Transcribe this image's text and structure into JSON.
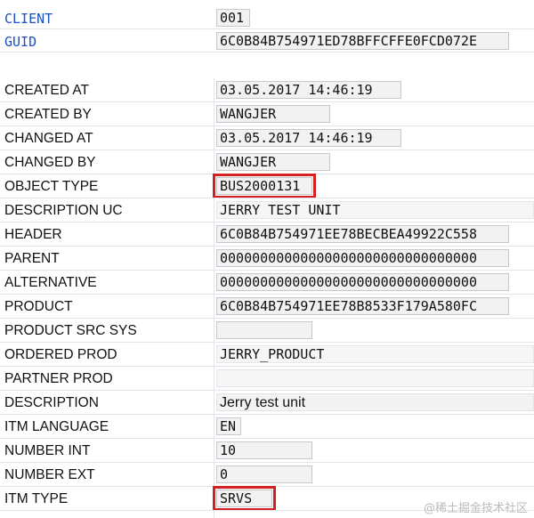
{
  "rows": [
    {
      "label": "CLIENT",
      "value": "001"
    },
    {
      "label": "GUID",
      "value": "6C0B84B754971ED78BFFCFFE0FCD072E"
    },
    {
      "label": "CREATED AT",
      "value": "03.05.2017 14:46:19"
    },
    {
      "label": "CREATED BY",
      "value": "WANGJER"
    },
    {
      "label": "CHANGED AT",
      "value": "03.05.2017 14:46:19"
    },
    {
      "label": "CHANGED BY",
      "value": "WANGJER"
    },
    {
      "label": "OBJECT TYPE",
      "value": "BUS2000131"
    },
    {
      "label": "DESCRIPTION UC",
      "value": "JERRY TEST UNIT"
    },
    {
      "label": "HEADER",
      "value": "6C0B84B754971EE78BECBEA49922C558"
    },
    {
      "label": "PARENT",
      "value": "00000000000000000000000000000000"
    },
    {
      "label": "ALTERNATIVE",
      "value": "00000000000000000000000000000000"
    },
    {
      "label": "PRODUCT",
      "value": "6C0B84B754971EE78B8533F179A580FC"
    },
    {
      "label": "PRODUCT SRC SYS",
      "value": ""
    },
    {
      "label": "ORDERED PROD",
      "value": "JERRY_PRODUCT"
    },
    {
      "label": "PARTNER PROD",
      "value": ""
    },
    {
      "label": "DESCRIPTION",
      "value": "Jerry test unit"
    },
    {
      "label": "ITM LANGUAGE",
      "value": "EN"
    },
    {
      "label": "NUMBER INT",
      "value": "10"
    },
    {
      "label": "NUMBER EXT",
      "value": "0"
    },
    {
      "label": "ITM TYPE",
      "value": "SRVS"
    }
  ],
  "highlight_color": "#d42020",
  "watermark": "@稀土掘金技术社区"
}
